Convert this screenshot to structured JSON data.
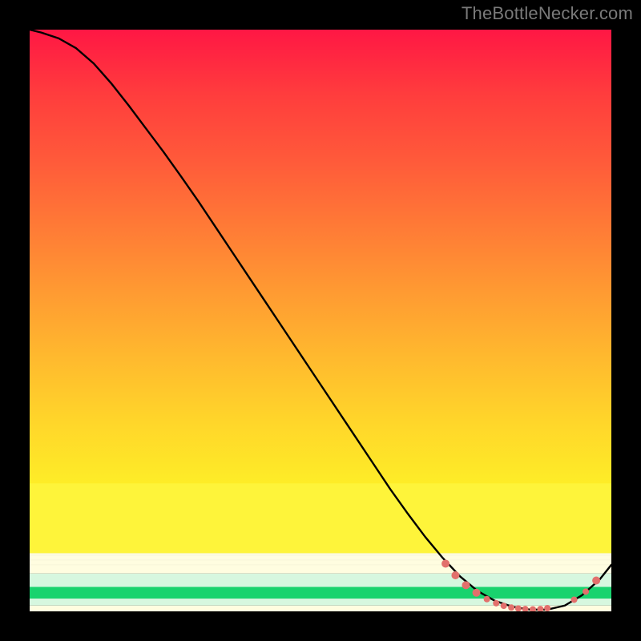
{
  "watermark": "TheBottleNecker.com",
  "chart_data": {
    "type": "line",
    "title": "",
    "xlabel": "",
    "ylabel": "",
    "xlim": [
      0,
      100
    ],
    "ylim": [
      0,
      100
    ],
    "x": [
      0,
      2,
      5,
      8,
      11,
      14,
      17,
      20,
      23,
      26,
      29,
      32,
      35,
      38,
      41,
      44,
      47,
      50,
      53,
      56,
      59,
      62,
      65,
      68,
      71,
      74,
      77,
      80,
      83,
      86,
      89,
      92,
      95,
      98,
      100
    ],
    "y": [
      100,
      99.5,
      98.5,
      96.8,
      94.2,
      90.8,
      87,
      83,
      79,
      74.8,
      70.5,
      66,
      61.5,
      57,
      52.5,
      48,
      43.5,
      39,
      34.5,
      30,
      25.5,
      21,
      16.8,
      12.8,
      9.2,
      6,
      3.5,
      1.8,
      0.8,
      0.3,
      0.3,
      1,
      2.8,
      5.5,
      8
    ],
    "marker_points": [
      {
        "x": 71.5,
        "y": 8.2,
        "r": 5
      },
      {
        "x": 73.2,
        "y": 6.2,
        "r": 5
      },
      {
        "x": 75.0,
        "y": 4.5,
        "r": 5
      },
      {
        "x": 76.8,
        "y": 3.2,
        "r": 5
      },
      {
        "x": 78.6,
        "y": 2.1,
        "r": 4
      },
      {
        "x": 80.2,
        "y": 1.4,
        "r": 4
      },
      {
        "x": 81.5,
        "y": 0.95,
        "r": 4
      },
      {
        "x": 82.8,
        "y": 0.65,
        "r": 4
      },
      {
        "x": 84.0,
        "y": 0.5,
        "r": 4
      },
      {
        "x": 85.2,
        "y": 0.4,
        "r": 4
      },
      {
        "x": 86.5,
        "y": 0.35,
        "r": 4
      },
      {
        "x": 87.8,
        "y": 0.4,
        "r": 4
      },
      {
        "x": 89.0,
        "y": 0.55,
        "r": 4
      },
      {
        "x": 93.6,
        "y": 2.0,
        "r": 4
      },
      {
        "x": 95.6,
        "y": 3.4,
        "r": 4
      },
      {
        "x": 97.4,
        "y": 5.3,
        "r": 5
      }
    ],
    "colors": {
      "curve": "#000000",
      "marker": "#e2706c",
      "gradient_main": [
        "#ff1744",
        "#ff3d3d",
        "#ff5a3a",
        "#ff7a36",
        "#ff9a32",
        "#ffb92e",
        "#ffd62a",
        "#feee27",
        "#f9f932"
      ],
      "band_pale_yellow": "#fffde0",
      "band_mint": "#d6f7df",
      "band_green": "#19d36e"
    }
  }
}
